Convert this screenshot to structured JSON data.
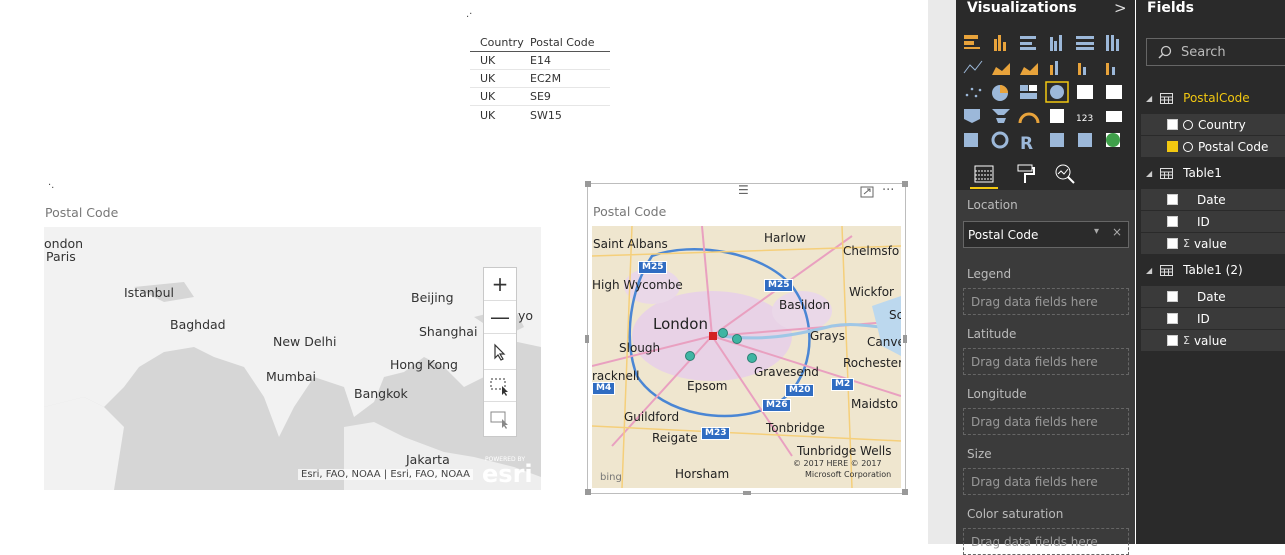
{
  "table_visual": {
    "headers": [
      "Country",
      "Postal Code"
    ],
    "rows": [
      [
        "UK",
        "E14"
      ],
      [
        "UK",
        "EC2M"
      ],
      [
        "UK",
        "SE9"
      ],
      [
        "UK",
        "SW15"
      ]
    ]
  },
  "map_left": {
    "title": "Postal Code",
    "labels": [
      "ondon",
      "Paris",
      "Istanbul",
      "Baghdad",
      "New Delhi",
      "Mumbai",
      "Beijing",
      "Shanghai",
      "yo",
      "Hong Kong",
      "Bangkok",
      "Jakarta"
    ],
    "attribution": "Esri, FAO, NOAA | Esri, FAO, NOAA",
    "brand": "esri",
    "brand_small": "POWERED BY",
    "zoom_in": "+",
    "zoom_out": "—"
  },
  "map_right": {
    "title": "Postal Code",
    "labels": [
      "Saint Albans",
      "Harlow",
      "Chelmsfo",
      "High Wycombe",
      "Basildon",
      "Wickfor",
      "London",
      "Sc",
      "Slough",
      "Grays",
      "Canve",
      "Rochester",
      "racknell",
      "Epsom",
      "Gravesend",
      "Maidsto",
      "Guildford",
      "Reigate",
      "Tonbridge",
      "Tunbridge Wells",
      "Horsham"
    ],
    "shields": [
      "M25",
      "M25",
      "M4",
      "M20",
      "M2",
      "M26",
      "M23"
    ],
    "attribution1": "© 2017 HERE   © 2017",
    "attribution2": "Microsoft Corporation",
    "bing": "bing",
    "point_color": "#3fb5a3",
    "selected_color": "#d42020"
  },
  "visualizations": {
    "title": "Visualizations",
    "chevron": ">",
    "wells": [
      {
        "label": "Location",
        "value": "Postal Code"
      },
      {
        "label": "Legend",
        "value": "Drag data fields here"
      },
      {
        "label": "Latitude",
        "value": "Drag data fields here"
      },
      {
        "label": "Longitude",
        "value": "Drag data fields here"
      },
      {
        "label": "Size",
        "value": "Drag data fields here"
      },
      {
        "label": "Color saturation",
        "value": "Drag data fields here"
      }
    ],
    "accent": "#f2c811"
  },
  "fields": {
    "title": "Fields",
    "search_placeholder": "Search",
    "tables": [
      {
        "name": "PostalCode",
        "items": [
          {
            "name": "Country",
            "checked": false
          },
          {
            "name": "Postal Code",
            "checked": true
          }
        ]
      },
      {
        "name": "Table1",
        "items": [
          {
            "name": "Date"
          },
          {
            "name": "ID"
          },
          {
            "name": "value"
          }
        ]
      },
      {
        "name": "Table1 (2)",
        "items": [
          {
            "name": "Date"
          },
          {
            "name": "ID"
          },
          {
            "name": "value"
          }
        ]
      }
    ]
  }
}
